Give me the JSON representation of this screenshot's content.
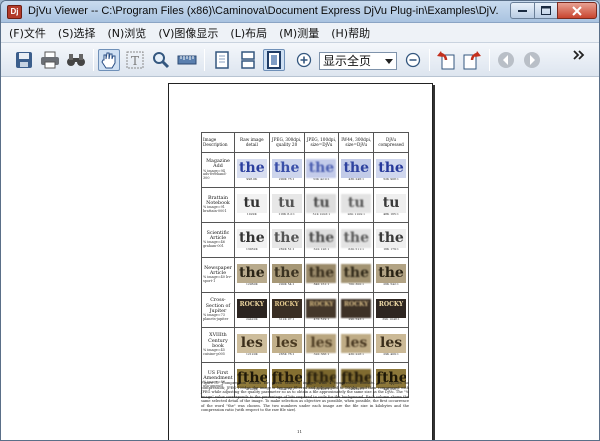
{
  "window": {
    "title": "DjVu Viewer -- C:\\Program Files (x86)\\Caminova\\Document Express DjVu Plug-in\\Examples\\DjV..."
  },
  "menu": {
    "items": [
      {
        "label": "(F)文件"
      },
      {
        "label": "(S)选择"
      },
      {
        "label": "(N)浏览"
      },
      {
        "label": "(V)图像显示"
      },
      {
        "label": "(L)布局"
      },
      {
        "label": "(M)测量"
      },
      {
        "label": "(H)帮助"
      }
    ]
  },
  "toolbar": {
    "zoom_value": "显示全页",
    "icons": [
      "save-icon",
      "print-icon",
      "find-icon",
      "hand-tool-icon",
      "text-select-icon",
      "zoom-tool-icon",
      "ruler-icon",
      "single-page-icon",
      "continuous-page-icon",
      "fit-page-icon",
      "zoom-in-icon",
      "zoom-out-icon",
      "rotate-left-icon",
      "rotate-right-icon",
      "back-icon",
      "forward-icon",
      "more-icon"
    ]
  },
  "document": {
    "headers": [
      "Image Description",
      "Raw image detail",
      "JPEG, 300dpi, quality 20",
      "JPEG, 100dpi, size=DjVu",
      "IW44, 300dpi, size=DjVu",
      "DjVu compressed"
    ],
    "rows": [
      {
        "name": "Magazine Add",
        "sub": "% image=94 ads-freehand-300",
        "glyph": "the",
        "style": "blue",
        "sizes": [
          "998.0K",
          "290K 73:1",
          "53K 42:0:1",
          "43K 246:1",
          "52K 908:1"
        ]
      },
      {
        "name": "Brattain Notebook",
        "sub": "% image=91 brattain-0001",
        "glyph": "tu",
        "style": "gray",
        "sizes": [
          "1022K",
          "116K 8.2:1",
          "51K 1003:1",
          "26K 1109:1",
          "48K 165:1"
        ]
      },
      {
        "name": "Scientific Article",
        "sub": "% image=46 graham-001",
        "glyph": "the",
        "style": "gray",
        "sizes": [
          "13032K",
          "262K 51:1",
          "61K 126:1",
          "63K 511:1",
          "16K 179:1"
        ]
      },
      {
        "name": "Newspaper Article",
        "sub": "% image=40 lrv-sport-1",
        "glyph": "the",
        "style": "brown",
        "sizes": [
          "12960K",
          "290K 54:1",
          "84K 161:1",
          "76K 300:1",
          "26K 542:1"
        ]
      },
      {
        "name": "Cross-Section of Jupiter",
        "sub": "% image=73 planets-jupiter",
        "glyph": "ROCKY",
        "style": "dark",
        "sizes": [
          "24420K",
          "312K 97:1",
          "47K 519:1",
          "29K 543:1",
          "39K 1048:1"
        ]
      },
      {
        "name": "XVIIIth Century book",
        "sub": "% image=45 cuisine-p005",
        "glyph": "les",
        "style": "tan",
        "sizes": [
          "12120K",
          "283K 76:1",
          "32K 366:1",
          "43K 228:1",
          "29K 409:1"
        ]
      },
      {
        "name": "US First Amendment",
        "sub": "% image=86 usa-amend1",
        "glyph": "ƒthe",
        "style": "gold",
        "sizes": [
          "31000K",
          "390K 79:1",
          "77K 403:1",
          "74K 395:1",
          "44K 690:1"
        ]
      }
    ],
    "caption": "Figure 1: Compression results for seven selected images with 4 compression formats. Raw applies no compression; JPEG-100dpi: the image is low-pass filtered and subsampled to 100dpi, and then compressed with JPEG while adjusting the quality parameter so as to obtain a file approximately the same size as the DjVu. The \"% image\" value corresponds to the percentage of bits required to code for the background. Each column shows the same selected detail of the image. To make selection as objective as possible, when possible, the first occurrence of the word \"the\" was chosen. The two numbers under each image are the file size in kilobytes and the compression ratio (with respect to the raw file size).",
    "page_number": "11"
  },
  "colors": {
    "title_bar": "#a9c3e0",
    "close_button": "#c8452f",
    "menu_bar": "#eef2f7",
    "viewer_bg": "#ffffff"
  }
}
